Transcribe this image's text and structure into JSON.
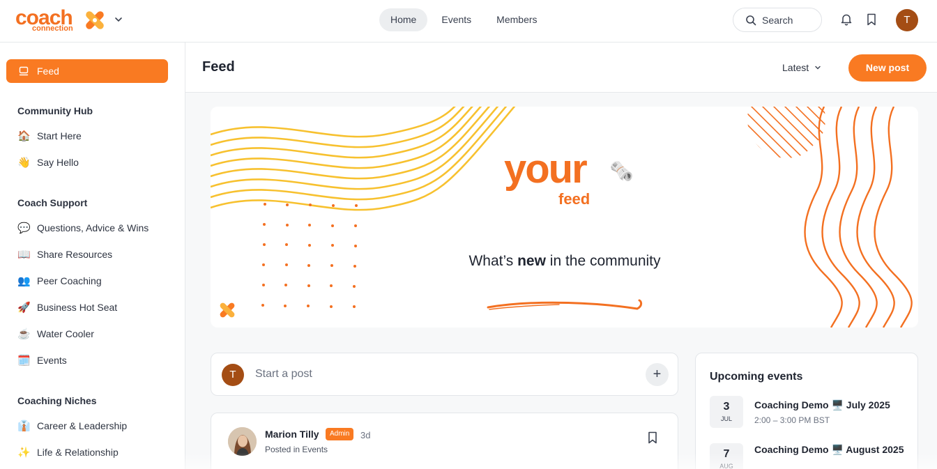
{
  "brand": {
    "name": "coach",
    "sub": "connection",
    "accent": "#f97a22",
    "dark_accent": "#a44d14"
  },
  "nav": {
    "items": [
      "Home",
      "Events",
      "Members"
    ],
    "active": "Home"
  },
  "search": {
    "label": "Search"
  },
  "user": {
    "initial": "T"
  },
  "sidebar": {
    "feed_label": "Feed",
    "sections": [
      {
        "title": "Community Hub",
        "items": [
          {
            "emoji": "🏠",
            "label": "Start Here"
          },
          {
            "emoji": "👋",
            "label": "Say Hello"
          }
        ]
      },
      {
        "title": "Coach Support",
        "items": [
          {
            "emoji": "💬",
            "label": "Questions, Advice & Wins"
          },
          {
            "emoji": "📖",
            "label": "Share Resources"
          },
          {
            "emoji": "👥",
            "label": "Peer Coaching"
          },
          {
            "emoji": "🚀",
            "label": "Business Hot Seat"
          },
          {
            "emoji": "☕",
            "label": "Water Cooler"
          },
          {
            "emoji": "🗓️",
            "label": "Events"
          }
        ]
      },
      {
        "title": "Coaching Niches",
        "items": [
          {
            "emoji": "👔",
            "label": "Career & Leadership"
          },
          {
            "emoji": "✨",
            "label": "Life & Relationship"
          }
        ]
      }
    ]
  },
  "header": {
    "title": "Feed",
    "sort_label": "Latest",
    "new_post_label": "New post"
  },
  "banner": {
    "big_word": "your",
    "small_word": "feed",
    "tag_before": "What’s ",
    "tag_bold": "new",
    "tag_after": " in the community",
    "emoji": "🗞️"
  },
  "composer": {
    "placeholder": "Start a post",
    "avatar_initial": "T",
    "plus": "+"
  },
  "post": {
    "author": "Marion Tilly",
    "badge": "Admin",
    "time": "3d",
    "meta": "Posted in Events"
  },
  "events": {
    "title": "Upcoming events",
    "items": [
      {
        "day": "3",
        "month": "JUL",
        "title": "Coaching Demo 🖥️ July 2025",
        "time": "2:00 – 3:00 PM BST"
      },
      {
        "day": "7",
        "month": "AUG",
        "title": "Coaching Demo 🖥️ August 2025",
        "time": ""
      }
    ]
  }
}
